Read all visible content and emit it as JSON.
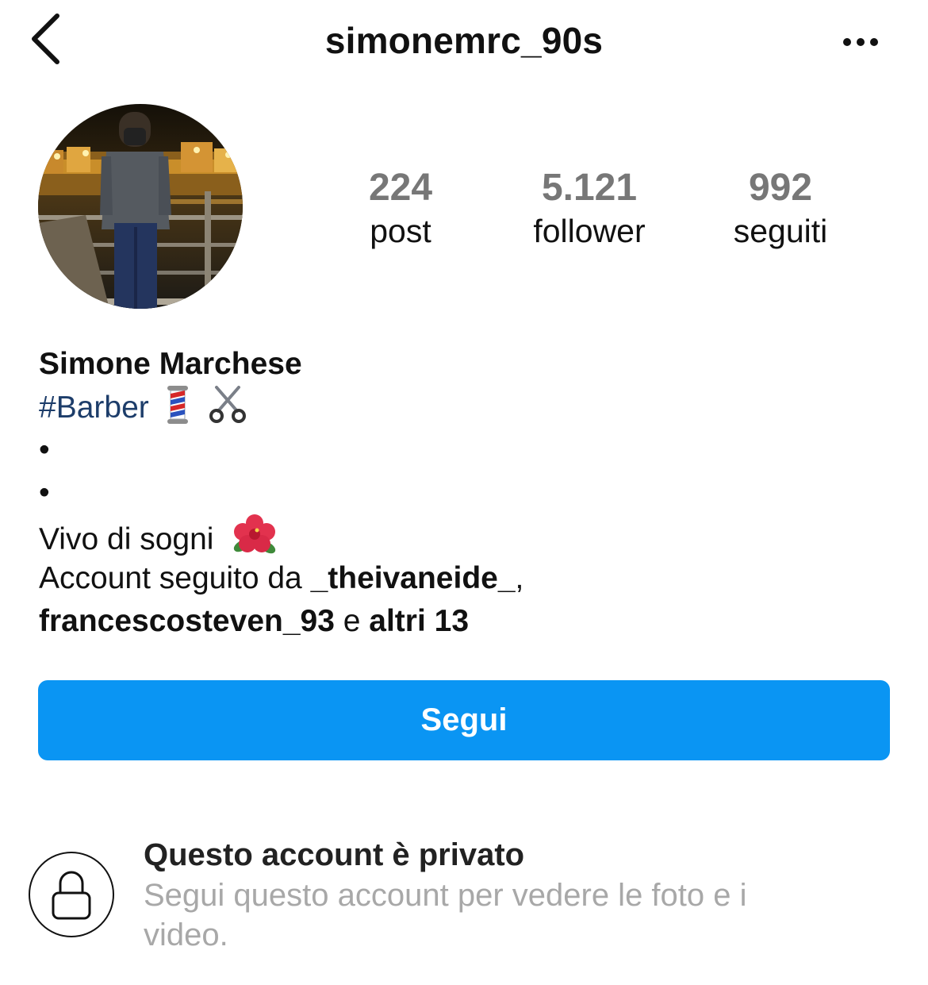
{
  "header": {
    "username": "simonemrc_90s",
    "back_icon": "chevron-left-icon",
    "more_icon": "more-horizontal-icon"
  },
  "stats": {
    "posts_count": "224",
    "posts_label": "post",
    "followers_count": "5.121",
    "followers_label": "follower",
    "following_count": "992",
    "following_label": "seguiti"
  },
  "bio": {
    "name": "Simone Marchese",
    "hashtag": "#Barber",
    "hashtag_emojis": [
      "barber-pole-emoji",
      "scissors-emoji"
    ],
    "dot1": "•",
    "dot2": "•",
    "text": "Vivo di sogni",
    "text_emoji": "hibiscus-emoji",
    "followed_by_prefix": "Account seguito da ",
    "followed_by_user1": "_theivaneide_",
    "comma": ",",
    "followed_by_user2": "francescosteven_93",
    "and": " e ",
    "others": "altri 13"
  },
  "follow_button": {
    "label": "Segui"
  },
  "private_notice": {
    "icon": "lock-icon",
    "title": "Questo account è privato",
    "subtitle": "Segui questo account per vedere le foto e i video."
  },
  "colors": {
    "follow_button_bg": "#0a95f3",
    "hashtag": "#1d3d6a",
    "stat_count": "#777777",
    "muted_text": "#a8a8a8"
  }
}
